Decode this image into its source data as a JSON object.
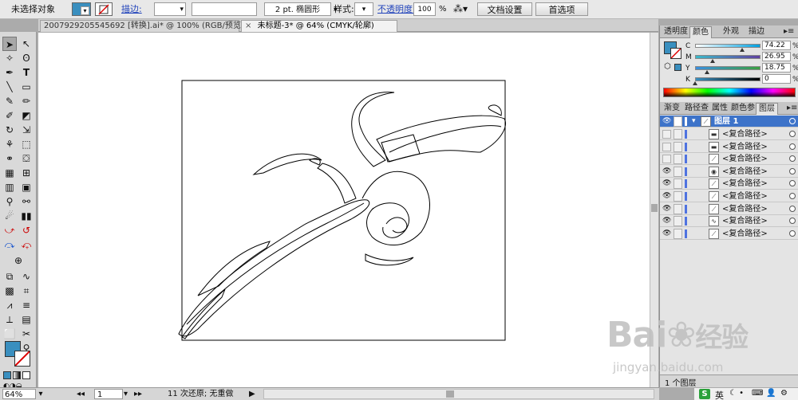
{
  "control_bar": {
    "selection_label": "未选择对象",
    "fill_color": "#3a8fbf",
    "stroke_label": "描边:",
    "brush_label": "2 pt. 椭圆形",
    "style_label": "样式:",
    "opacity_label": "不透明度:",
    "opacity_value": "100",
    "opacity_unit": "%",
    "doc_setup_button": "文档设置",
    "prefs_button": "首选项"
  },
  "document_tabs": [
    {
      "label": "2007929205545692 [转换].ai* @ 100% (RGB/预览)",
      "close": "×",
      "active": false
    },
    {
      "label": "未标题-3* @ 64% (CMYK/轮廓)",
      "close": "×",
      "active": true
    }
  ],
  "status_bar": {
    "zoom": "64%",
    "page": "1",
    "undo_info": "11 次还原; 无重做"
  },
  "color_panel": {
    "tabs": [
      "透明度",
      "颜色",
      "外观",
      "描边"
    ],
    "active_tab": "颜色",
    "fill_swatch": "#3a8fbf",
    "sliders": [
      {
        "label": "C",
        "value": "74.22",
        "unit": "%",
        "level": 74.22
      },
      {
        "label": "M",
        "value": "26.95",
        "unit": "%",
        "level": 26.95
      },
      {
        "label": "Y",
        "value": "18.75",
        "unit": "%",
        "level": 18.75
      },
      {
        "label": "K",
        "value": "0",
        "unit": "%",
        "level": 0
      }
    ]
  },
  "layers_panel": {
    "tabs": [
      "渐变",
      "路径查",
      "属性",
      "颜色参",
      "图层"
    ],
    "active_tab": "图层",
    "layer_name": "图层 1",
    "items": [
      {
        "name": "<复合路径>",
        "visible": false
      },
      {
        "name": "<复合路径>",
        "visible": false
      },
      {
        "name": "<复合路径>",
        "visible": false
      },
      {
        "name": "<复合路径>",
        "visible": true
      },
      {
        "name": "<复合路径>",
        "visible": true
      },
      {
        "name": "<复合路径>",
        "visible": true
      },
      {
        "name": "<复合路径>",
        "visible": true
      },
      {
        "name": "<复合路径>",
        "visible": true
      },
      {
        "name": "<复合路径>",
        "visible": true
      }
    ],
    "footer_count": "1 个图层"
  },
  "taskbar": {
    "ime": "英",
    "ime_logo": "S"
  },
  "watermark": {
    "brand": "Bai",
    "brand2": "经验",
    "url": "jingyan.baidu.com"
  }
}
